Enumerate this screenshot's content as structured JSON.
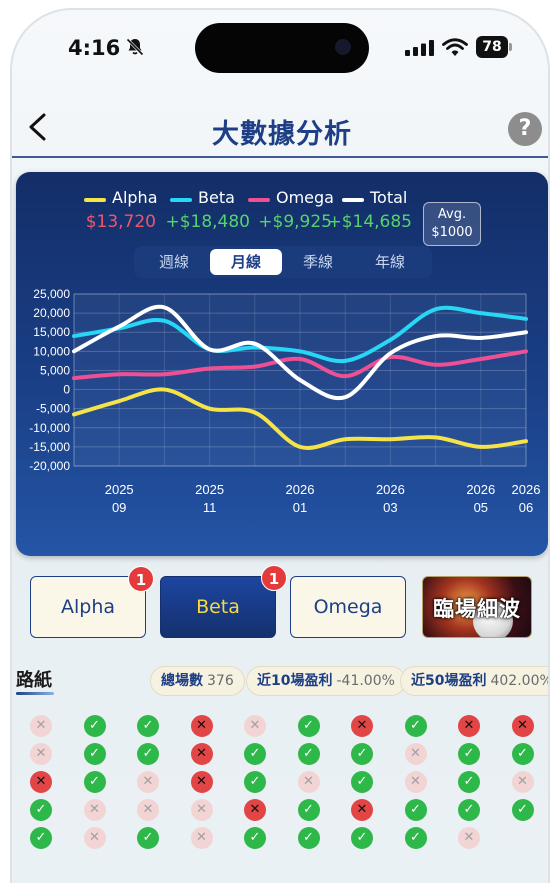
{
  "status_bar": {
    "time": "4:16",
    "battery": "78",
    "icons": [
      "bell-slash-icon",
      "cellular-signal-icon",
      "wifi-icon",
      "battery-icon"
    ]
  },
  "header": {
    "title": "大數據分析",
    "back_icon": "chevron-left-icon",
    "help_label": "?"
  },
  "legend": [
    {
      "name": "Alpha",
      "value": "$13,720",
      "color": "#f5e34a",
      "value_color": "#f0566a"
    },
    {
      "name": "Beta",
      "value": "+$18,480",
      "color": "#28d7f5",
      "value_color": "#56d36a"
    },
    {
      "name": "Omega",
      "value": "+$9,925",
      "color": "#ef4f93",
      "value_color": "#56d36a"
    },
    {
      "name": "Total",
      "value": "+$14,685",
      "color": "#ffffff",
      "value_color": "#56d36a"
    }
  ],
  "avg_button": {
    "line1": "Avg.",
    "line2": "$1000"
  },
  "period_tabs": [
    {
      "label": "週線",
      "active": false
    },
    {
      "label": "月線",
      "active": true
    },
    {
      "label": "季線",
      "active": false
    },
    {
      "label": "年線",
      "active": false
    }
  ],
  "chart_data": {
    "type": "line",
    "title": "",
    "xlabel": "",
    "ylabel": "",
    "ylim": [
      -20000,
      25000
    ],
    "y_ticks": [
      "25,000",
      "20,000",
      "15,000",
      "10,000",
      "5,000",
      "0",
      "-5,000",
      "-10,000",
      "-15,000",
      "-20,000"
    ],
    "x_ticks": [
      {
        "year": "2025",
        "month": "09"
      },
      {
        "year": "2025",
        "month": "11"
      },
      {
        "year": "2026",
        "month": "01"
      },
      {
        "year": "2026",
        "month": "03"
      },
      {
        "year": "2026",
        "month": "05"
      },
      {
        "year": "2026",
        "month": "06"
      }
    ],
    "x": [
      "2025-08",
      "2025-09",
      "2025-10",
      "2025-11",
      "2025-12",
      "2026-01",
      "2026-02",
      "2026-03",
      "2026-04",
      "2026-05",
      "2026-06"
    ],
    "series": [
      {
        "name": "Alpha",
        "color": "#f5e34a",
        "values": [
          -6500,
          -3000,
          0,
          -5000,
          -6000,
          -15000,
          -13000,
          -13000,
          -12500,
          -15000,
          -13500
        ]
      },
      {
        "name": "Beta",
        "color": "#28d7f5",
        "values": [
          14000,
          16000,
          18000,
          10500,
          11000,
          10000,
          7500,
          13000,
          21000,
          20000,
          18500
        ]
      },
      {
        "name": "Omega",
        "color": "#ef4f93",
        "values": [
          3000,
          4000,
          4000,
          5500,
          6000,
          8000,
          3500,
          8500,
          6500,
          8000,
          10000
        ]
      },
      {
        "name": "Total",
        "color": "#ffffff",
        "values": [
          10000,
          16500,
          21500,
          10500,
          12000,
          2500,
          -2000,
          9500,
          14000,
          13500,
          15000
        ]
      }
    ],
    "grid": true
  },
  "bet_tabs": [
    {
      "label": "Alpha",
      "badge": "",
      "style": "light"
    },
    {
      "label": "Beta",
      "badge": "1",
      "style": "dark"
    },
    {
      "label": "Omega",
      "badge": "",
      "style": "light"
    }
  ],
  "live_banner": {
    "label": "臨場細波",
    "badge": "1"
  },
  "road": {
    "title": "路紙",
    "stats": [
      {
        "key": "總場數",
        "value": "376"
      },
      {
        "key": "近10場盈利",
        "value": "-41.00%"
      },
      {
        "key": "近50場盈利",
        "value": "402.00%"
      }
    ],
    "symbols": {
      "win": "✓",
      "loss": "✕",
      "void": "✕"
    },
    "columns": [
      [
        "void",
        "void",
        "loss",
        "win",
        "win"
      ],
      [
        "win",
        "win",
        "win",
        "void",
        "void"
      ],
      [
        "win",
        "win",
        "void",
        "void",
        "win"
      ],
      [
        "loss",
        "loss",
        "loss",
        "void",
        "void"
      ],
      [
        "void",
        "win",
        "win",
        "loss",
        "win"
      ],
      [
        "win",
        "win",
        "void",
        "win",
        "win"
      ],
      [
        "loss",
        "win",
        "win",
        "loss",
        "win"
      ],
      [
        "win",
        "void",
        "void",
        "win",
        "win"
      ],
      [
        "loss",
        "win",
        "win",
        "win",
        "void"
      ],
      [
        "loss",
        "win",
        "void",
        "win",
        ""
      ]
    ]
  }
}
